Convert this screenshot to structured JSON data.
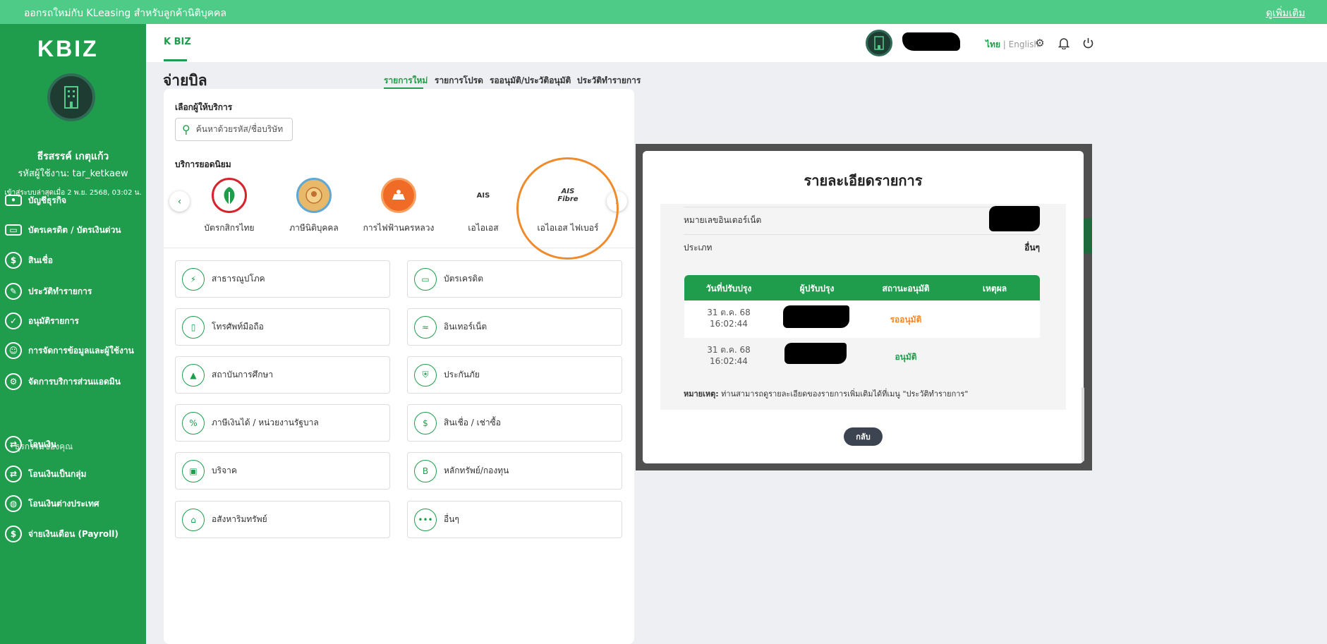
{
  "banner": {
    "text": "ออกรถใหม่กับ KLeasing สำหรับลูกค้านิติบุคคล",
    "more": "ดูเพิ่มเติม"
  },
  "sidebar": {
    "logo": "KBIZ",
    "user_name": "ธีรสรรค์ เกตุแก้ว",
    "user_id": "รหัสผู้ใช้งาน: tar_ketkaew",
    "last_login": "เข้าสู่ระบบล่าสุดเมื่อ 2 พ.ย. 2568, 03:02 น.",
    "items": [
      {
        "label": "บัญชีธุรกิจ"
      },
      {
        "label": "บัตรเครดิต / บัตรเงินด่วน"
      },
      {
        "label": "สินเชื่อ"
      },
      {
        "label": "ประวัติทำรายการ"
      },
      {
        "label": "อนุมัติรายการ"
      },
      {
        "label": "การจัดการข้อมูลและผู้ใช้งาน"
      },
      {
        "label": "จัดการบริการส่วนแอดมิน"
      }
    ],
    "section_label": "ธุรกรรมของคุณ",
    "tx_items": [
      {
        "label": "โอนเงิน"
      },
      {
        "label": "โอนเงินเป็นกลุ่ม"
      },
      {
        "label": "โอนเงินต่างประเทศ"
      },
      {
        "label": "จ่ายเงินเดือน (Payroll)"
      }
    ]
  },
  "header": {
    "tab": "K BIZ",
    "lang_th": "ไทย",
    "lang_en": "English"
  },
  "page": {
    "title": "จ่ายบิล",
    "tabs": [
      "รายการใหม่",
      "รายการโปรด",
      "รออนุมัติ/ประวัติอนุมัติ",
      "ประวัติทำรายการ"
    ]
  },
  "biller": {
    "choose_label": "เลือกผู้ให้บริการ",
    "search_placeholder": "ค้นหาด้วยรหัส/ชื่อบริษัท",
    "popular_label": "บริการยอดนิยม",
    "favorites": [
      {
        "name": "บัตรกสิกรไทย",
        "mark": "K"
      },
      {
        "name": "ภาษีนิติบุคคล",
        "mark": ""
      },
      {
        "name": "การไฟฟ้านครหลวง",
        "mark": ""
      },
      {
        "name": "เอไอเอส",
        "mark": "AIS"
      },
      {
        "name": "เอไอเอส ไฟเบอร์",
        "mark": "AIS Fibre"
      }
    ],
    "categories": [
      {
        "label": "สาธารณูปโภค"
      },
      {
        "label": "บัตรเครดิต"
      },
      {
        "label": "โทรศัพท์มือถือ"
      },
      {
        "label": "อินเทอร์เน็ต"
      },
      {
        "label": "สถาบันการศึกษา"
      },
      {
        "label": "ประกันภัย"
      },
      {
        "label": "ภาษีเงินได้ / หน่วยงานรัฐบาล"
      },
      {
        "label": "สินเชื่อ / เช่าซื้อ"
      },
      {
        "label": "บริจาค"
      },
      {
        "label": "หลักทรัพย์/กองทุน"
      },
      {
        "label": "อสังหาริมทรัพย์"
      },
      {
        "label": "อื่นๆ"
      }
    ]
  },
  "modal": {
    "title": "รายละเอียดรายการ",
    "internet_label": "หมายเลขอินเตอร์เน็ต",
    "type_label": "ประเภท",
    "type_value": "อื่นๆ",
    "table": {
      "headers": [
        "วันที่ปรับปรุง",
        "ผู้ปรับปรุง",
        "สถานะอนุมัติ",
        "เหตุผล"
      ],
      "rows": [
        {
          "date": "31 ต.ค. 68",
          "time": "16:02:44",
          "status": "รออนุมัติ",
          "status_color": "#f08a2a"
        },
        {
          "date": "31 ต.ค. 68",
          "time": "16:02:44",
          "status": "อนุมัติ",
          "status_color": "#1f9d4c"
        }
      ]
    },
    "note_bold": "หมายเหตุ:",
    "note_text": " ท่านสามารถดูรายละเอียดของรายการเพิ่มเติมได้ที่เมนู \"ประวัติทำรายการ\"",
    "back_label": "กลับ"
  }
}
